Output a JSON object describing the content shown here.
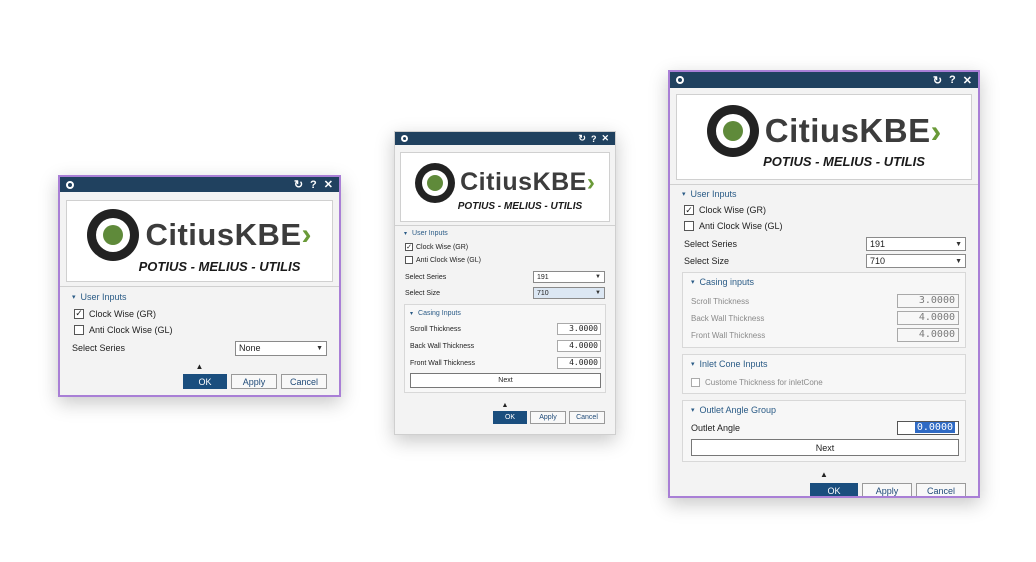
{
  "dialogs": [
    {
      "logo": {
        "brand": "CitiusKBE",
        "tagline": "POTIUS - MELIUS - UTILIS"
      },
      "user_inputs": {
        "title": "User Inputs",
        "clockwise_label": "Clock Wise (GR)",
        "clockwise_checked": true,
        "anticlockwise_label": "Anti Clock Wise (GL)",
        "anticlockwise_checked": false,
        "series_label": "Select Series",
        "series_value": "None"
      },
      "buttons": {
        "ok": "OK",
        "apply": "Apply",
        "cancel": "Cancel"
      }
    },
    {
      "logo": {
        "brand": "CitiusKBE",
        "tagline": "POTIUS - MELIUS - UTILIS"
      },
      "user_inputs": {
        "title": "User Inputs",
        "clockwise_label": "Clock Wise (GR)",
        "clockwise_checked": true,
        "anticlockwise_label": "Anti Clock Wise (GL)",
        "anticlockwise_checked": false,
        "series_label": "Select Series",
        "series_value": "191",
        "size_label": "Select Size",
        "size_value": "710"
      },
      "casing": {
        "title": "Casing Inputs",
        "scroll_label": "Scroll Thickness",
        "scroll_value": "3.0000",
        "back_label": "Back Wall Thickness",
        "back_value": "4.0000",
        "front_label": "Front Wall Thickness",
        "front_value": "4.0000",
        "next": "Next"
      },
      "buttons": {
        "ok": "OK",
        "apply": "Apply",
        "cancel": "Cancel"
      }
    },
    {
      "logo": {
        "brand": "CitiusKBE",
        "tagline": "POTIUS - MELIUS - UTILIS"
      },
      "user_inputs": {
        "title": "User Inputs",
        "clockwise_label": "Clock Wise (GR)",
        "clockwise_checked": true,
        "anticlockwise_label": "Anti Clock Wise (GL)",
        "anticlockwise_checked": false,
        "series_label": "Select Series",
        "series_value": "191",
        "size_label": "Select Size",
        "size_value": "710"
      },
      "casing": {
        "title": "Casing inputs",
        "scroll_label": "Scroll Thickness",
        "scroll_value": "3.0000",
        "back_label": "Back Wall Thickness",
        "back_value": "4.0000",
        "front_label": "Front Wall Thickness",
        "front_value": "4.0000"
      },
      "inlet": {
        "title": "Inlet Cone Inputs",
        "custom_label": "Custome Thickness for inletCone"
      },
      "outlet": {
        "title": "Outlet Angle Group",
        "angle_label": "Outlet Angle",
        "angle_value": "0.0000",
        "next": "Next"
      },
      "buttons": {
        "ok": "OK",
        "apply": "Apply",
        "cancel": "Cancel"
      }
    }
  ],
  "colors": {
    "titlebar": "#20415f",
    "accent": "#2a5b86",
    "logo_green": "#6a9a38",
    "border_purple": "#a97fd6"
  },
  "glyphs": {
    "reset": "↻",
    "help": "?",
    "close": "✕",
    "check": "✓",
    "collapse": "▲",
    "expand": "▾",
    "dropdown": "▼"
  }
}
